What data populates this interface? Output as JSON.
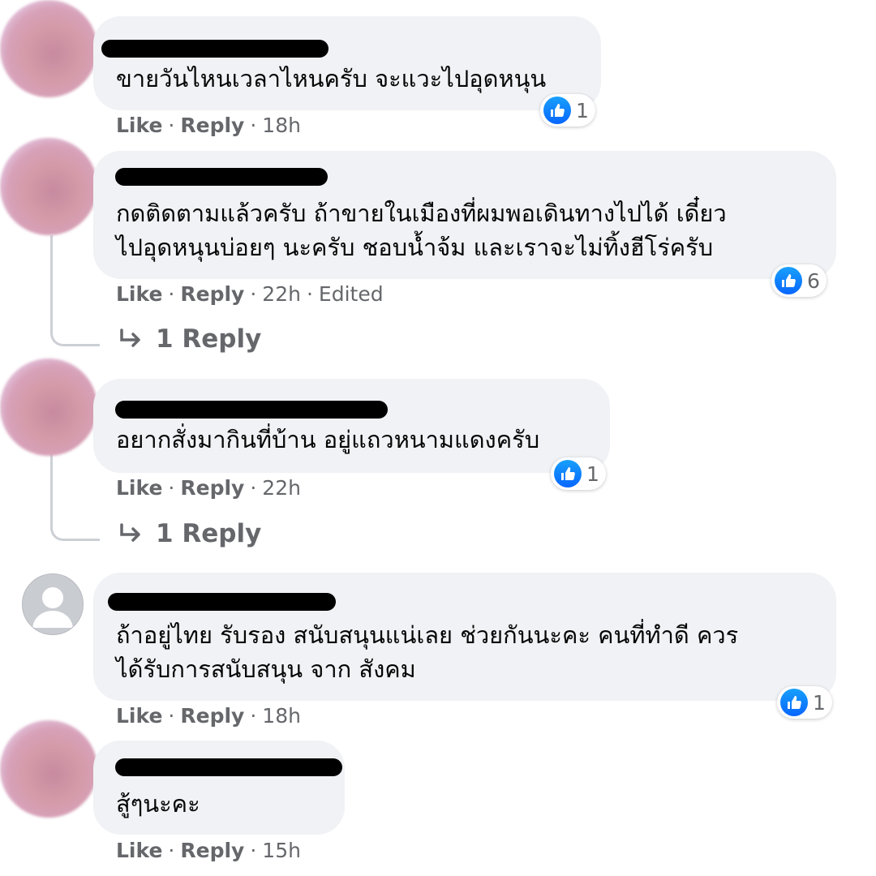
{
  "meta_labels": {
    "like": "Like",
    "reply": "Reply",
    "dot": "·"
  },
  "comments": [
    {
      "lines": [
        "ขายวันไหนเวลาไหนครับ จะแวะไปอุดหนุน"
      ],
      "time": "18h",
      "edited": "",
      "reactions": "1",
      "icon": "like-icon"
    },
    {
      "lines": [
        "กดติดตามแล้วครับ ถ้าขายในเมืองที่ผมพอเดินทางไปได้ เดี๋ยว",
        "ไปอุดหนุนบ่อยๆ นะครับ ชอบน้ำจ้ม และเราจะไม่ทิ้งฮีโร่ครับ"
      ],
      "time": "22h",
      "edited": "Edited",
      "reactions": "6",
      "replies": "1 Reply",
      "icon": "like-icon"
    },
    {
      "lines": [
        "อยากสั่งมากินที่บ้าน อยู่แถวหนามแดงครับ"
      ],
      "time": "22h",
      "edited": "",
      "reactions": "1",
      "replies": "1 Reply",
      "icon": "like-icon"
    },
    {
      "lines": [
        "ถ้าอยู่ไทย รับรอง สนับสนุนแน่เลย ช่วยกันนะคะ คนที่ทำดี ควร",
        "ได้รับการสนับสนุน จาก สังคม"
      ],
      "time": "18h",
      "edited": "",
      "reactions": "1",
      "icon": "like-icon"
    },
    {
      "lines": [
        "สู้ๆนะคะ"
      ],
      "time": "15h",
      "edited": "",
      "icon": "like-icon"
    }
  ],
  "colors": {
    "bubble": "#f0f2f5",
    "meta": "#65676b",
    "like_blue": "#0866ff",
    "thread_line": "#ccd0d5"
  }
}
